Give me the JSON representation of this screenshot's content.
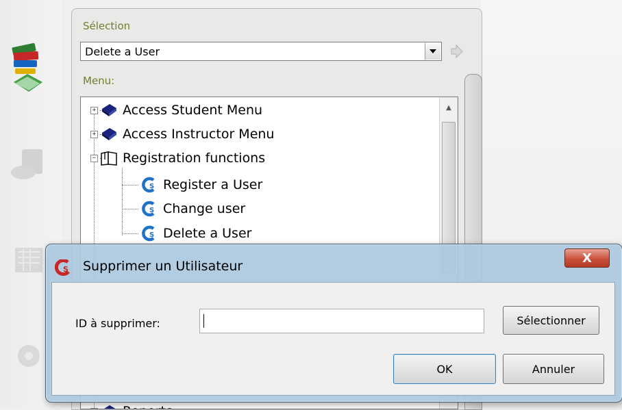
{
  "panel": {
    "selection_label": "Sélection",
    "selection_value": "Delete a User",
    "menu_label": "Menu:"
  },
  "tree": {
    "items": [
      {
        "label": "Access Student Menu",
        "icon": "book-icon",
        "expander": "+"
      },
      {
        "label": "Access Instructor Menu",
        "icon": "book-icon",
        "expander": "+"
      },
      {
        "label": "Registration functions",
        "icon": "open-book-icon",
        "expander": "−"
      },
      {
        "label": "Register a User",
        "icon": "app-c-icon"
      },
      {
        "label": "Change user",
        "icon": "app-c-icon"
      },
      {
        "label": "Delete a User",
        "icon": "app-c-icon"
      },
      {
        "label": "Reports",
        "icon": "book-icon",
        "expander": "+"
      }
    ]
  },
  "dialog": {
    "title": "Supprimer un Utilisateur",
    "close_label": "X",
    "id_label": "ID à supprimer:",
    "id_value": "",
    "select_button": "Sélectionner",
    "ok_button": "OK",
    "cancel_button": "Annuler"
  },
  "colors": {
    "label_green": "#6f7f2d",
    "dialog_frame": "#abc9de",
    "close_red": "#c9513b",
    "app_icon_blue": "#1e73c8"
  }
}
